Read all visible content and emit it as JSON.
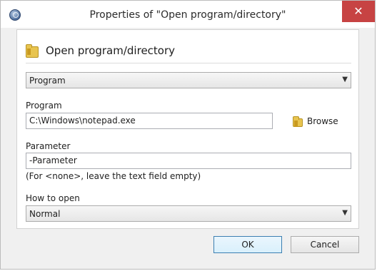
{
  "window": {
    "title": "Properties of \"Open program/directory\""
  },
  "titlebar": {
    "close_glyph": "✕"
  },
  "header": {
    "title": "Open program/directory"
  },
  "action_type": {
    "selected": "Program",
    "chevron": "⌄"
  },
  "program": {
    "label": "Program",
    "value": "C:\\Windows\\notepad.exe",
    "browse_label": "Browse"
  },
  "parameter": {
    "label": "Parameter",
    "value": "-Parameter",
    "hint": "(For <none>, leave the text field empty)"
  },
  "how_to_open": {
    "label": "How to open",
    "selected": "Normal",
    "chevron": "⌄"
  },
  "buttons": {
    "ok": "OK",
    "cancel": "Cancel"
  },
  "icons": {
    "app": "app-globe-icon",
    "folder": "folder-icon",
    "close": "close-icon"
  },
  "colors": {
    "close_button": "#c74343",
    "default_button_border": "#3c7fb1",
    "folder": "#e8c44f"
  }
}
